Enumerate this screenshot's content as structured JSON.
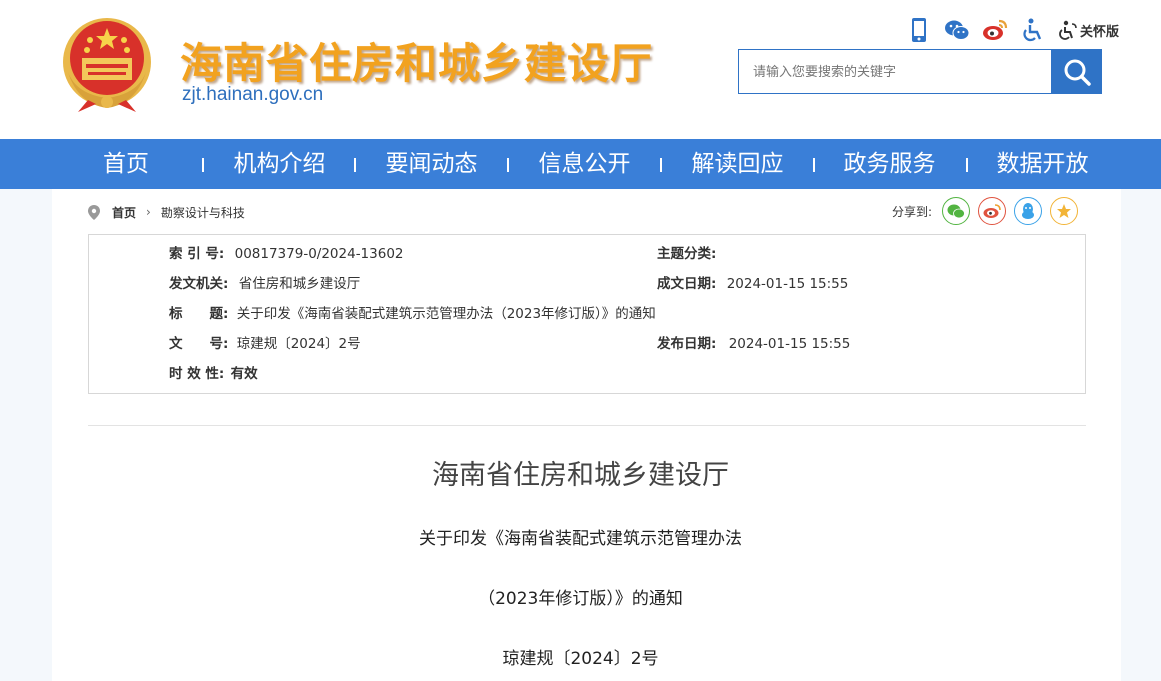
{
  "header": {
    "site_title": "海南省住房和城乡建设厅",
    "site_url": "zjt.hainan.gov.cn",
    "care_mode_label": "关怀版",
    "icons": [
      "mobile-icon",
      "wechat-icon",
      "weibo-icon",
      "accessibility-icon",
      "care-mode-icon"
    ],
    "search_placeholder": "请输入您要搜索的关键字"
  },
  "nav": {
    "items": [
      {
        "label": "首页"
      },
      {
        "label": "机构介绍"
      },
      {
        "label": "要闻动态"
      },
      {
        "label": "信息公开"
      },
      {
        "label": "解读回应"
      },
      {
        "label": "政务服务"
      },
      {
        "label": "数据开放"
      }
    ]
  },
  "breadcrumb": {
    "home": "首页",
    "current": "勘察设计与科技"
  },
  "share": {
    "label": "分享到:",
    "targets": [
      "wechat-share-icon",
      "weibo-share-icon",
      "qq-share-icon",
      "favorite-share-icon"
    ]
  },
  "meta": {
    "index_label": "索 引 号:",
    "index_value": "00817379-0/2024-13602",
    "topic_label": "主题分类:",
    "topic_value": "",
    "issuer_label": "发文机关:",
    "issuer_value": "省住房和城乡建设厅",
    "written_date_label": "成文日期:",
    "written_date_value": "2024-01-15 15:55",
    "title_label": "标　　题:",
    "title_value": "关于印发《海南省装配式建筑示范管理办法（2023年修订版）》的通知",
    "doc_no_label": "文　　号:",
    "doc_no_value": "琼建规〔2024〕2号",
    "publish_date_label": "发布日期:",
    "publish_date_value": "2024-01-15 15:55",
    "validity_label": "时 效 性:",
    "validity_value": "有效"
  },
  "document": {
    "heading": "海南省住房和城乡建设厅",
    "title_line1": "关于印发《海南省装配式建筑示范管理办法",
    "title_line2": "（2023年修订版）》的通知",
    "doc_number": "琼建规〔2024〕2号"
  },
  "colors": {
    "nav_bg": "#3a7fd8",
    "search_button": "#2f73c6",
    "title_gold": "#f2a21f",
    "url_blue": "#2e6fbd"
  }
}
